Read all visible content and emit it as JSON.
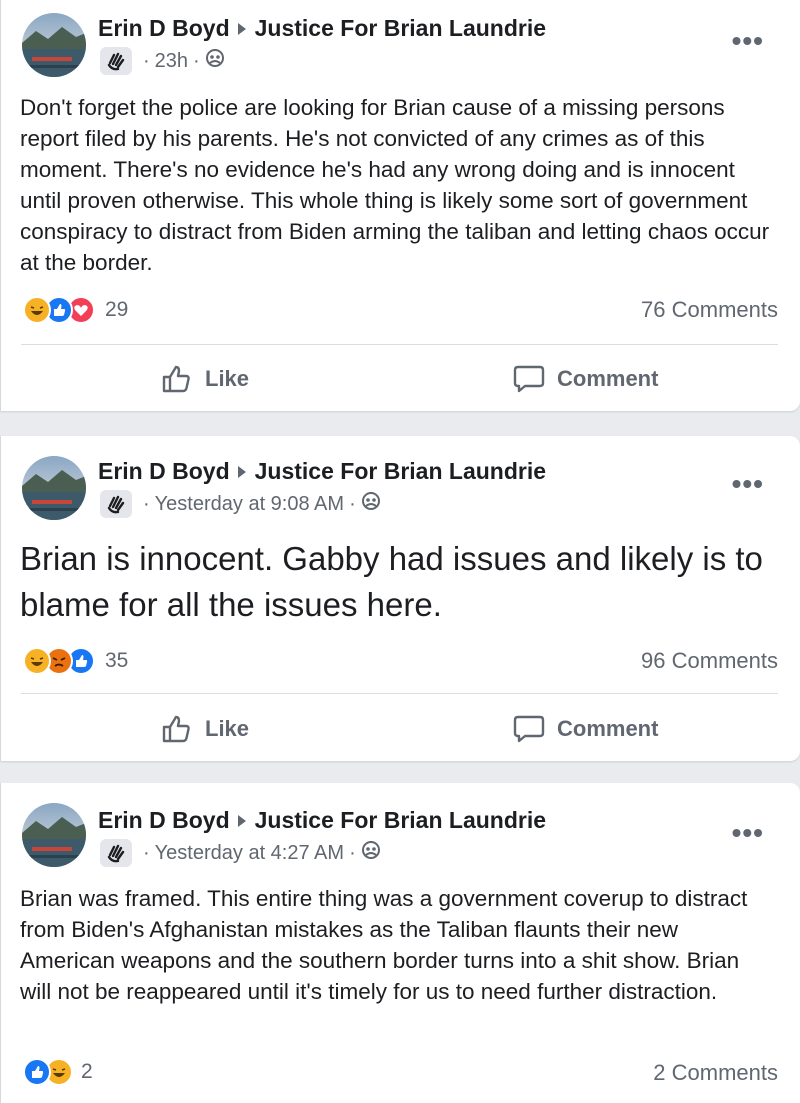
{
  "posts": [
    {
      "author": "Erin D Boyd",
      "group": "Justice For Brian Laundrie",
      "time": "23h",
      "text": "Don't forget the police are looking for Brian cause of a missing persons report filed by his parents. He's not convicted of any crimes as of this moment. There's no evidence he's had any wrong doing and is innocent until proven otherwise.  This whole thing is likely some sort of government conspiracy to distract from Biden arming the taliban and letting chaos occur at the border.",
      "reactions": [
        "haha",
        "like",
        "love"
      ],
      "reaction_count": "29",
      "comments": "76 Comments",
      "like_label": "Like",
      "comment_label": "Comment"
    },
    {
      "author": "Erin D Boyd",
      "group": "Justice For Brian Laundrie",
      "time": "Yesterday at 9:08 AM",
      "text": "Brian is innocent. Gabby had issues and likely is to blame for all the issues here.",
      "reactions": [
        "haha",
        "angry",
        "like"
      ],
      "reaction_count": "35",
      "comments": "96 Comments",
      "like_label": "Like",
      "comment_label": "Comment"
    },
    {
      "author": "Erin D Boyd",
      "group": "Justice For Brian Laundrie",
      "time": "Yesterday at 4:27 AM",
      "text": "Brian was framed. This entire thing was a government coverup to distract from Biden's Afghanistan mistakes as the Taliban flaunts their new American weapons and the southern border turns into a shit show. Brian will not be reappeared until it's timely for us to need further distraction.",
      "reactions": [
        "like",
        "haha"
      ],
      "reaction_count": "2",
      "comments": "2 Comments"
    }
  ],
  "icons": {
    "more": "more-options-icon",
    "badge": "waving-hand-icon",
    "privacy": "group-audience-icon",
    "like": "thumbs-up-icon",
    "comment": "speech-bubble-icon"
  },
  "colors": {
    "like_blue": "#1877f2",
    "love_red": "#f33e58",
    "haha_yellow": "#f7b125",
    "angry_orange": "#e9710f",
    "secondary_text": "#606770"
  }
}
